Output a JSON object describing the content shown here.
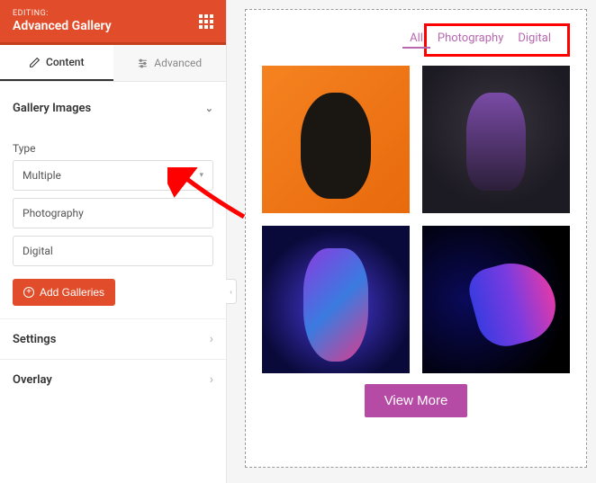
{
  "header": {
    "editing": "EDITING:",
    "title": "Advanced Gallery"
  },
  "tabs": {
    "content": "Content",
    "advanced": "Advanced"
  },
  "gallery": {
    "heading": "Gallery Images",
    "type_label": "Type",
    "type_value": "Multiple",
    "fields": [
      "Photography",
      "Digital"
    ],
    "add_btn": "Add Galleries"
  },
  "accordions": {
    "settings": "Settings",
    "overlay": "Overlay"
  },
  "preview": {
    "filters": [
      "All",
      "Photography",
      "Digital"
    ],
    "view_more": "View More"
  }
}
